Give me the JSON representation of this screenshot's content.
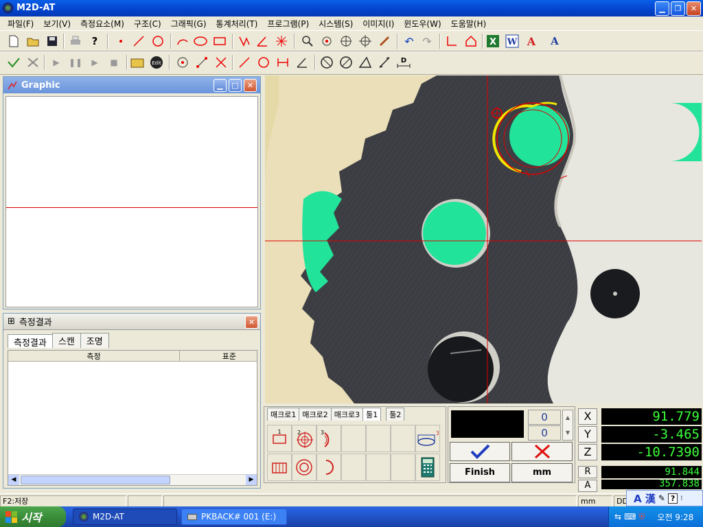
{
  "window": {
    "title": "M2D-AT"
  },
  "menu": [
    "파일(F)",
    "보기(V)",
    "측정요소(M)",
    "구조(C)",
    "그래픽(G)",
    "통계처리(T)",
    "프로그램(P)",
    "시스템(S)",
    "이미지(I)",
    "윈도우(W)",
    "도움말(H)"
  ],
  "graphic_panel": {
    "title": "Graphic"
  },
  "results_panel": {
    "title": "측정결과",
    "tabs": [
      "측정결과",
      "스캔",
      "조명"
    ],
    "columns": [
      "측정",
      "표준"
    ]
  },
  "tool_panel": {
    "tabs": [
      "매크로1",
      "매크로2",
      "매크로3",
      "툴1",
      "툴2"
    ],
    "active_tab": "툴1"
  },
  "counters": {
    "top": "0",
    "bottom": "0"
  },
  "actions": {
    "finish": "Finish",
    "unit": "mm"
  },
  "dro": {
    "x": {
      "label": "X",
      "value": "91.779"
    },
    "y": {
      "label": "Y",
      "value": "-3.465"
    },
    "z": {
      "label": "Z",
      "value": "-10.7390"
    },
    "r": {
      "label": "R",
      "value": "91.844"
    },
    "a": {
      "label": "A",
      "value": "357.838"
    }
  },
  "status": {
    "left": "F2:저장",
    "unit": "mm",
    "extra": "DD"
  },
  "ime": {
    "label": "A 漢"
  },
  "taskbar": {
    "start": "시작",
    "tasks": [
      "M2D-AT",
      "PKBACK# 001 (E:)"
    ],
    "clock": "오전 9:28"
  },
  "colors": {
    "accent": "#0A5FE8",
    "dro_text": "#3CFF3C",
    "crosshair": "#E00000",
    "highlight": "#22E39A"
  }
}
